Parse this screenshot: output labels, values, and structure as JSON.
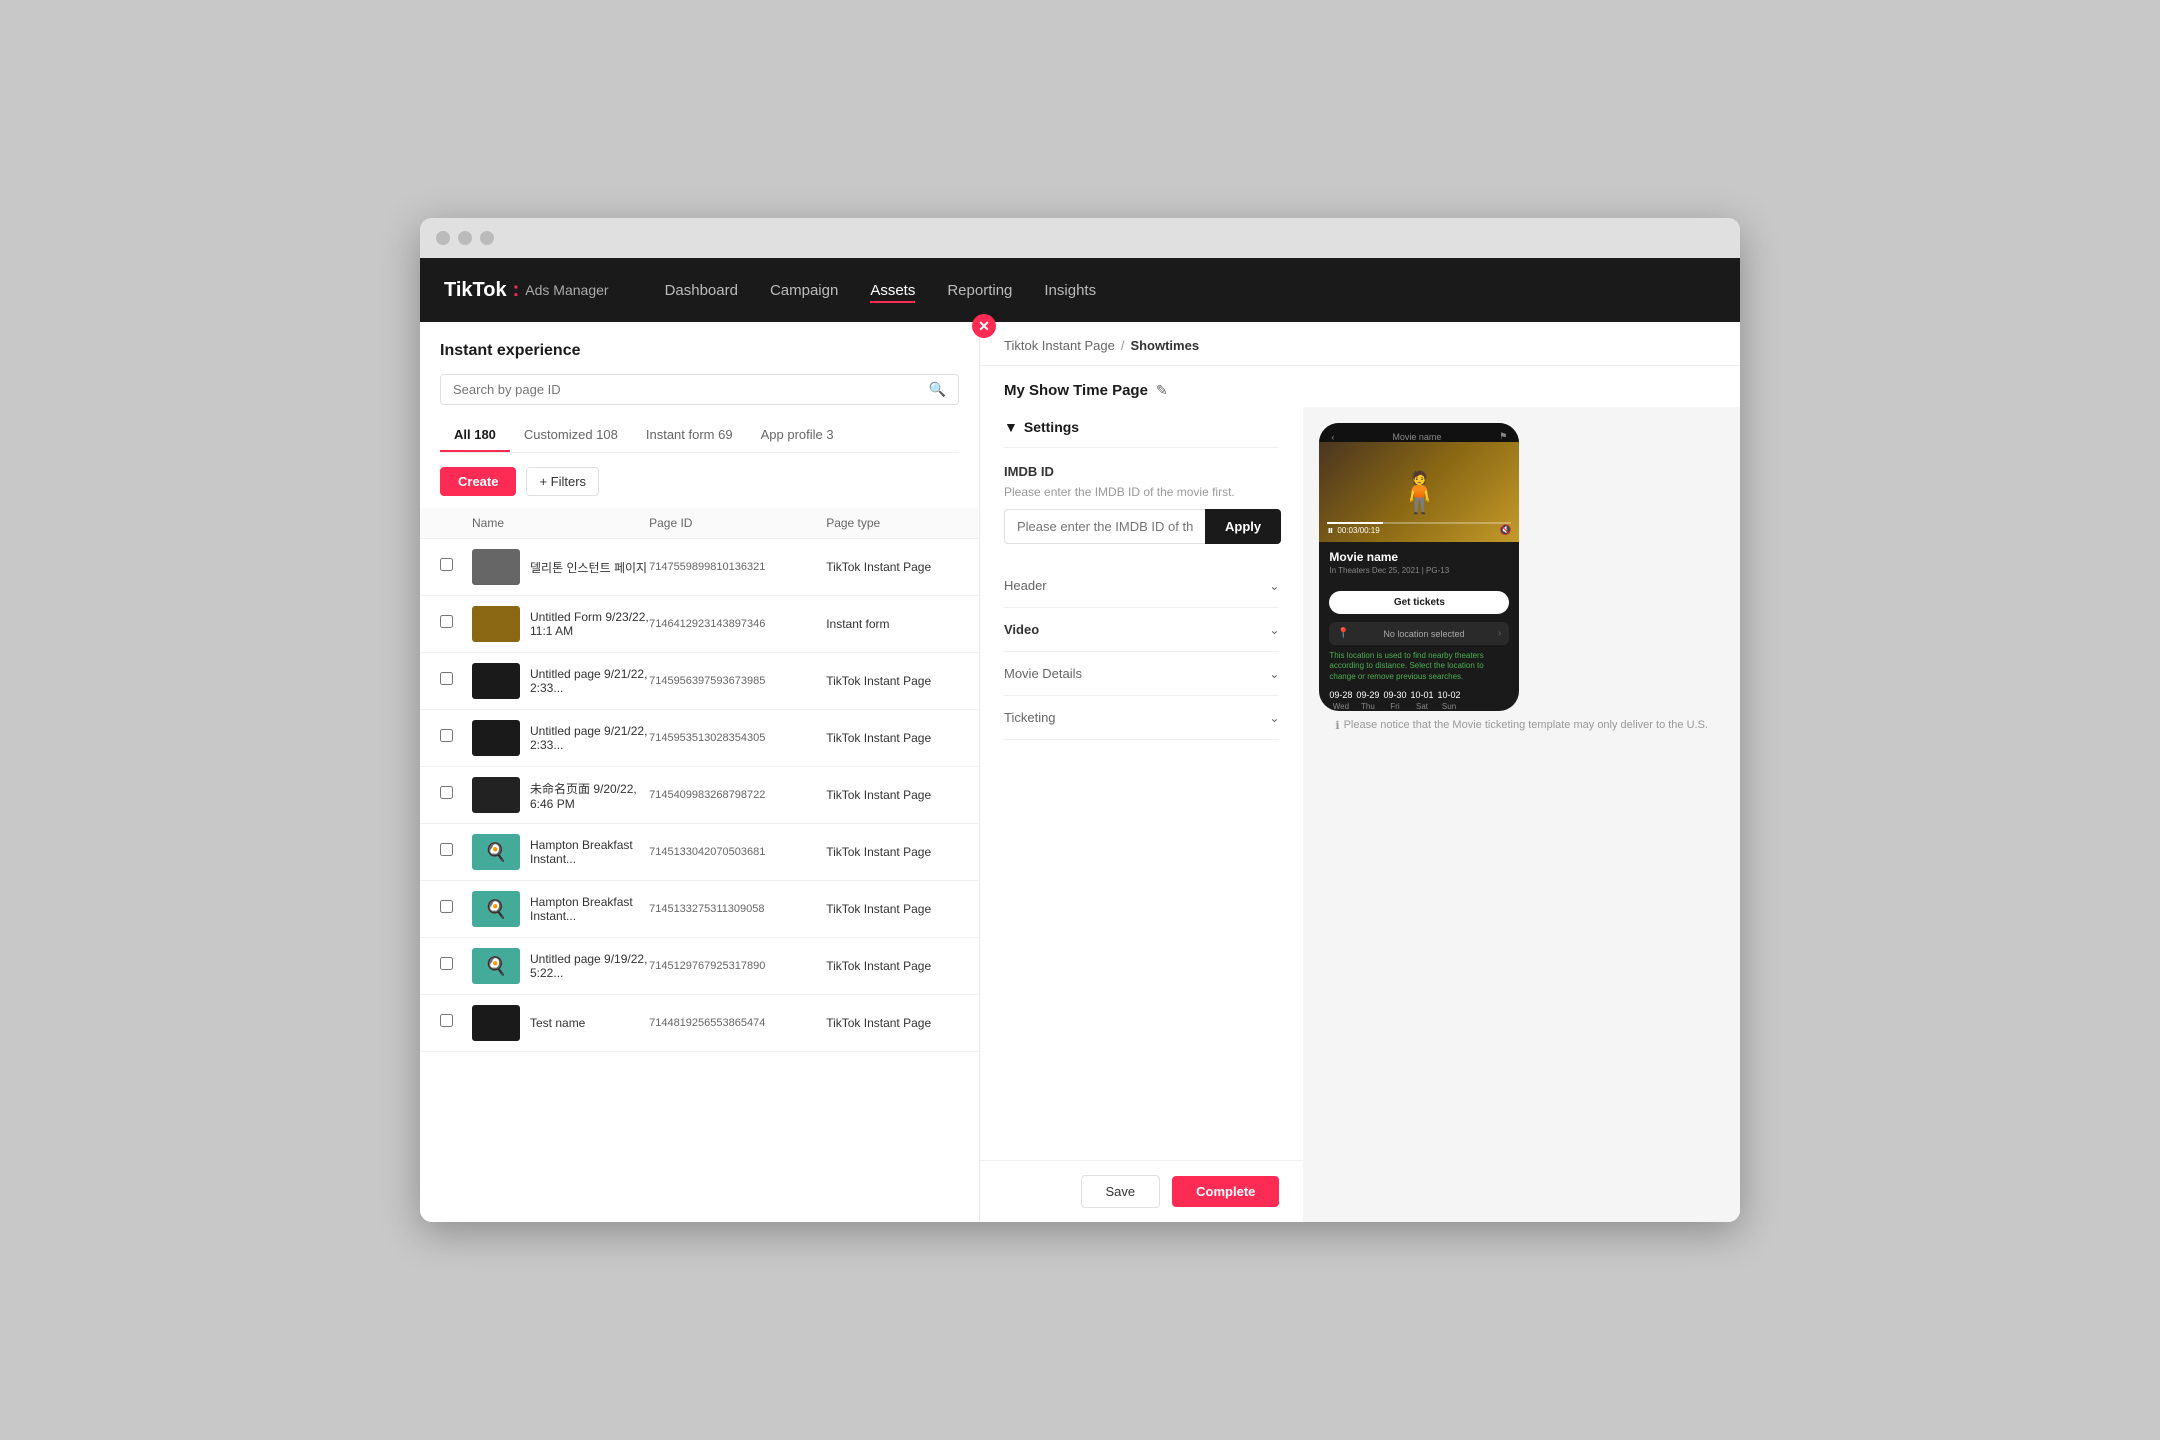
{
  "window": {
    "title": "TikTok Ads Manager"
  },
  "nav": {
    "logo_tiktok": "TikTok",
    "logo_dot": ":",
    "logo_ads": "Ads Manager",
    "items": [
      {
        "id": "dashboard",
        "label": "Dashboard",
        "active": false
      },
      {
        "id": "campaign",
        "label": "Campaign",
        "active": false
      },
      {
        "id": "assets",
        "label": "Assets",
        "active": true
      },
      {
        "id": "reporting",
        "label": "Reporting",
        "active": false
      },
      {
        "id": "insights",
        "label": "Insights",
        "active": false
      }
    ]
  },
  "left_panel": {
    "title": "Instant experience",
    "search_placeholder": "Search by page ID",
    "tabs": [
      {
        "id": "all",
        "label": "All 180",
        "active": true
      },
      {
        "id": "customized",
        "label": "Customized 108",
        "active": false
      },
      {
        "id": "instant_form",
        "label": "Instant form 69",
        "active": false
      },
      {
        "id": "app_profile",
        "label": "App profile 3",
        "active": false
      }
    ],
    "create_label": "Create",
    "filters_label": "+ Filters",
    "table": {
      "columns": [
        "Name",
        "Page ID",
        "Page type"
      ],
      "rows": [
        {
          "id": 1,
          "name": "델리톤 인스턴트 페이지",
          "page_id": "7147559899810136321",
          "page_type": "TikTok Instant Page",
          "thumb_color": "#555"
        },
        {
          "id": 2,
          "name": "Untitled Form 9/23/22, 11:1 AM",
          "page_id": "7146412923143897346",
          "page_type": "Instant form",
          "thumb_color": "#8b6914"
        },
        {
          "id": 3,
          "name": "Untitled page 9/21/22, 2:33...",
          "page_id": "7145956397593673985",
          "page_type": "TikTok Instant Page",
          "thumb_color": "#1a1a1a"
        },
        {
          "id": 4,
          "name": "Untitled page 9/21/22, 2:33...",
          "page_id": "7145953513028354305",
          "page_type": "TikTok Instant Page",
          "thumb_color": "#1a1a1a"
        },
        {
          "id": 5,
          "name": "未命名页面 9/20/22, 6:46 PM",
          "page_id": "7145409983268798722",
          "page_type": "TikTok Instant Page",
          "thumb_color": "#222"
        },
        {
          "id": 6,
          "name": "Hampton Breakfast Instant...",
          "page_id": "7145133042070503681",
          "page_type": "TikTok Instant Page",
          "thumb_color": "#4a9"
        },
        {
          "id": 7,
          "name": "Hampton Breakfast Instant...",
          "page_id": "7145133275311309058",
          "page_type": "TikTok Instant Page",
          "thumb_color": "#4a9"
        },
        {
          "id": 8,
          "name": "Untitled page 9/19/22, 5:22...",
          "page_id": "7145129767925317890",
          "page_type": "TikTok Instant Page",
          "thumb_color": "#4a9"
        },
        {
          "id": 9,
          "name": "Test name",
          "page_id": "7144819256553865474",
          "page_type": "TikTok Instant Page",
          "thumb_color": "#1a1a1a"
        }
      ]
    }
  },
  "showtimes": {
    "breadcrumb_link": "Tiktok Instant Page",
    "breadcrumb_sep": "/",
    "breadcrumb_current": "Showtimes",
    "page_name": "My Show Time Page",
    "settings_label": "▾ Settings",
    "imdb": {
      "label": "IMDB ID",
      "hint": "Please enter the IMDB ID of the movie first.",
      "placeholder": "Please enter the IMDB ID of the movie",
      "apply_label": "Apply"
    },
    "accordion": [
      {
        "id": "header",
        "label": "Header",
        "bold": false
      },
      {
        "id": "video",
        "label": "Video",
        "bold": true
      },
      {
        "id": "movie_details",
        "label": "Movie Details",
        "bold": false
      },
      {
        "id": "ticketing",
        "label": "Ticketing",
        "bold": false
      }
    ]
  },
  "phone": {
    "movie_name": "Movie name",
    "movie_sub": "In Theaters  Dec 25, 2021  |  PG-13",
    "time_current": "00:03",
    "time_total": "00:19",
    "get_tickets": "Get tickets",
    "no_location": "No location selected",
    "location_note": "This location is used to find nearby theaters according to distance. Select the location to change or remove previous searches.",
    "dates": [
      {
        "day": "Wed",
        "num": "09-28"
      },
      {
        "day": "Thu",
        "num": "09-29"
      },
      {
        "day": "Fri",
        "num": "09-30"
      },
      {
        "day": "Sat",
        "num": "10-01"
      },
      {
        "day": "Sun",
        "num": "10-02"
      }
    ],
    "notice": "Please notice that the Movie ticketing template may only deliver to the U.S."
  },
  "footer": {
    "save_label": "Save",
    "complete_label": "Complete"
  }
}
